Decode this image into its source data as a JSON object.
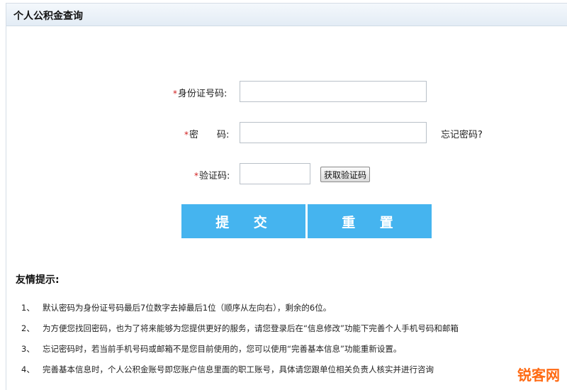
{
  "header": {
    "title": "个人公积金查询"
  },
  "form": {
    "id_label": "身份证号码:",
    "id_value": "",
    "password_label": "密　　码:",
    "password_value": "",
    "forgot_label": "忘记密码?",
    "captcha_label": "验证码:",
    "captcha_value": "",
    "get_code_label": "获取验证码",
    "required_mark": "*"
  },
  "buttons": {
    "submit_label": "提 交",
    "reset_label": "重 置",
    "color": "#45b4ef"
  },
  "tips": {
    "title": "友情提示:",
    "items": [
      {
        "num": "1、",
        "text": "默认密码为身份证号码最后7位数字去掉最后1位（顺序从左向右），剩余的6位。"
      },
      {
        "num": "2、",
        "text": "为方便您找回密码，也为了将来能够为您提供更好的服务，请您登录后在“信息修改”功能下完善个人手机号码和邮箱"
      },
      {
        "num": "3、",
        "text": "忘记密码时，若当前手机号码或邮箱不是您目前使用的，您可以使用“完善基本信息”功能重新设置。"
      },
      {
        "num": "4、",
        "text": "完善基本信息时，个人公积金账号即您账户信息里面的职工账号，具体请您跟单位相关负责人核实并进行咨询"
      }
    ]
  },
  "watermark": {
    "text": "锐客网"
  }
}
